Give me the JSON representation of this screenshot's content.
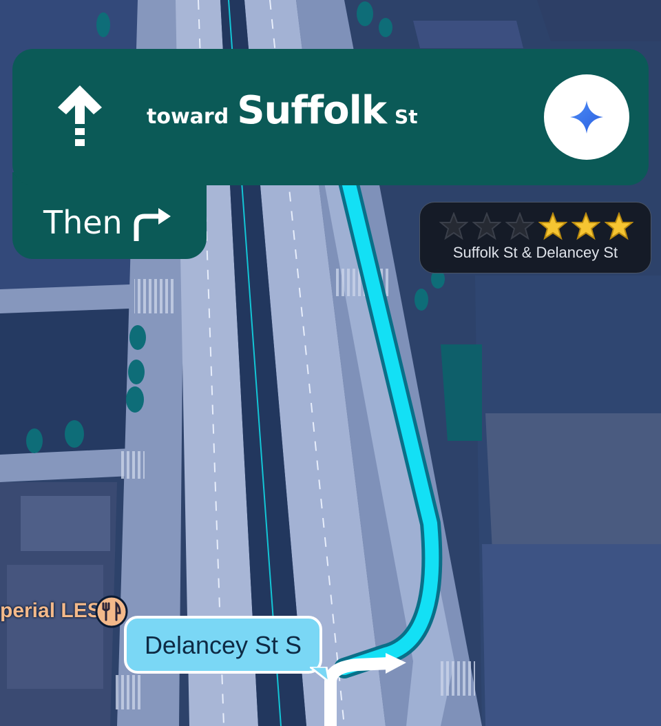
{
  "navigation": {
    "direction_icon": "straight-arrow-icon",
    "toward_label": "toward",
    "street_name": "Suffolk",
    "street_suffix": "St",
    "then_label": "Then",
    "then_icon": "turn-right-icon",
    "assistant_icon": "gemini-sparkle-icon"
  },
  "rating_prompt": {
    "stars_total": 6,
    "stars_highlighted": 3,
    "location": "Suffolk St & Delancey St"
  },
  "map": {
    "poi_label": "perial LES",
    "poi_icon": "restaurant-icon",
    "current_street": "Delancey St S"
  },
  "colors": {
    "nav_card": "#0b5a57",
    "route": "#13e0f5",
    "star_active": "#f6c532",
    "street_bubble": "#7ad7f5"
  }
}
